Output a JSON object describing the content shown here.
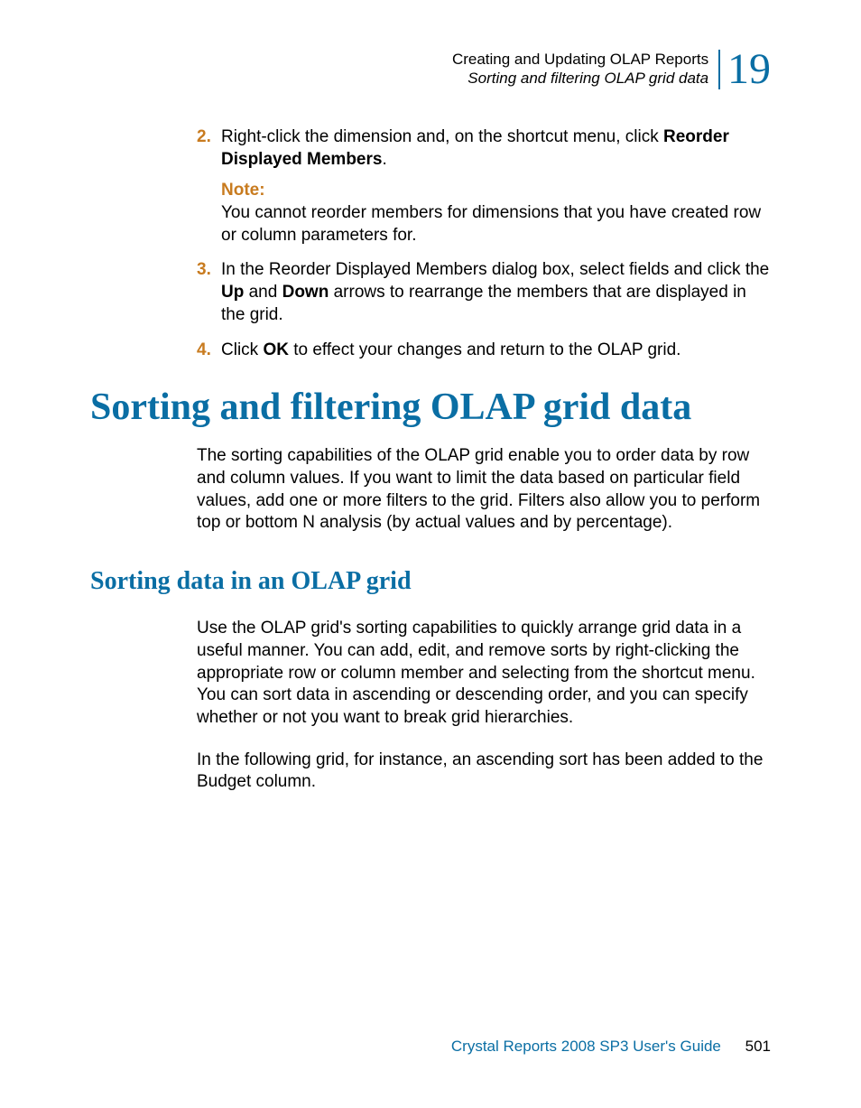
{
  "header": {
    "chapter_title": "Creating and Updating OLAP Reports",
    "section_title": "Sorting and filtering OLAP grid data",
    "chapter_number": "19"
  },
  "steps": {
    "s2": {
      "num": "2.",
      "pre": "Right-click the dimension and, on the shortcut menu, click ",
      "bold": "Reorder Displayed Members",
      "post": "."
    },
    "note": {
      "label": "Note:",
      "body": "You cannot reorder members for dimensions that you have created row or column parameters for."
    },
    "s3": {
      "num": "3.",
      "pre": "In the Reorder Displayed Members dialog box, select fields and click the ",
      "bold1": "Up",
      "mid": " and ",
      "bold2": "Down",
      "post": " arrows to rearrange the members that are displayed in the grid."
    },
    "s4": {
      "num": "4.",
      "pre": "Click ",
      "bold": "OK",
      "post": " to effect your changes and return to the OLAP grid."
    }
  },
  "h1": "Sorting and filtering OLAP grid data",
  "intro_para": "The sorting capabilities of the OLAP grid enable you to order data by row and column values. If you want to limit the data based on particular field values, add one or more filters to the grid. Filters also allow you to perform top or bottom N analysis (by actual values and by percentage).",
  "h2": "Sorting data in an OLAP grid",
  "para2": "Use the OLAP grid's sorting capabilities to quickly arrange grid data in a useful manner. You can add, edit, and remove sorts by right-clicking the appropriate row or column member and selecting from the shortcut menu. You can sort data in ascending or descending order, and you can specify whether or not you want to break grid hierarchies.",
  "para3": "In the following grid, for instance, an ascending sort has been added to the Budget column.",
  "footer": {
    "guide": "Crystal Reports 2008 SP3 User's Guide",
    "page": "501"
  }
}
